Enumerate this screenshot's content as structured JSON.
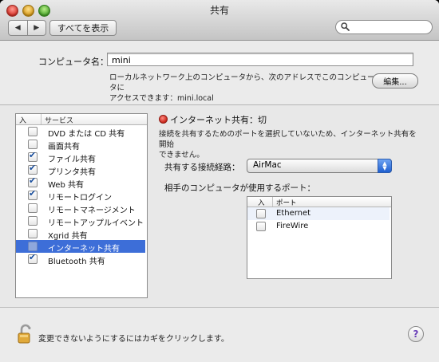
{
  "window": {
    "title": "共有"
  },
  "toolbar": {
    "back_glyph": "◀",
    "forward_glyph": "▶",
    "show_all_label": "すべてを表示",
    "search_placeholder": ""
  },
  "computer_name": {
    "label": "コンピュータ名：",
    "value": "mini",
    "description_line1": "ローカルネットワーク上のコンピュータから、次のアドレスでこのコンピュータに",
    "description_line2": "アクセスできます：mini.local",
    "edit_button": "編集..."
  },
  "services": {
    "header_on": "入",
    "header_service": "サービス",
    "items": [
      {
        "label": "DVD または CD 共有",
        "checked": false,
        "selected": false
      },
      {
        "label": "画面共有",
        "checked": false,
        "selected": false
      },
      {
        "label": "ファイル共有",
        "checked": true,
        "selected": false
      },
      {
        "label": "プリンタ共有",
        "checked": true,
        "selected": false
      },
      {
        "label": "Web 共有",
        "checked": true,
        "selected": false
      },
      {
        "label": "リモートログイン",
        "checked": true,
        "selected": false
      },
      {
        "label": "リモートマネージメント",
        "checked": false,
        "selected": false
      },
      {
        "label": "リモートアップルイベント",
        "checked": false,
        "selected": false
      },
      {
        "label": "Xgrid 共有",
        "checked": false,
        "selected": false
      },
      {
        "label": "インターネット共有",
        "checked": false,
        "selected": true
      },
      {
        "label": "Bluetooth 共有",
        "checked": true,
        "selected": false
      }
    ]
  },
  "detail": {
    "status_text": "インターネット共有：切",
    "status_color": "#c8241a",
    "description_line1": "接続を共有するためのポートを選択していないため、インターネット共有を開始",
    "description_line2": "できません。",
    "route_label": "共有する接続経路：",
    "route_value": "AirMac",
    "ports_label": "相手のコンピュータが使用するポート：",
    "ports_header_on": "入",
    "ports_header_port": "ポート",
    "ports": [
      {
        "label": "Ethernet",
        "checked": false
      },
      {
        "label": "FireWire",
        "checked": false
      }
    ]
  },
  "footer": {
    "lock_text": "変更できないようにするにはカギをクリックします。",
    "help_glyph": "?"
  }
}
